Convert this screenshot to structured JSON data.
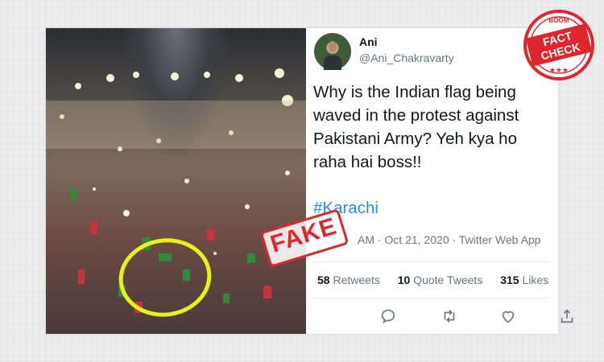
{
  "tweet": {
    "display_name": "Ani",
    "handle": "@Ani_Chakravarty",
    "text": "Why is the Indian flag being waved in the protest against Pakistani Army? Yeh kya ho raha hai boss!!",
    "hashtag": "#Karachi",
    "meta": "AM · Oct 21, 2020 · Twitter Web App",
    "stats": [
      {
        "count": "58",
        "label": "Retweets"
      },
      {
        "count": "10",
        "label": "Quote Tweets"
      },
      {
        "count": "315",
        "label": "Likes"
      }
    ]
  },
  "stamps": {
    "fake": "FAKE",
    "fact_check_top": "FACT",
    "fact_check_bottom": "CHECK",
    "fact_check_brand": "BOOM",
    "stars": "★★★"
  },
  "icons": {
    "reply": "reply-icon",
    "retweet": "retweet-icon",
    "like": "heart-icon",
    "share": "share-icon"
  },
  "colors": {
    "stamp_red": "#e0262d",
    "hashtag_blue": "#1b95e0",
    "highlight_yellow": "#e6f21a"
  }
}
